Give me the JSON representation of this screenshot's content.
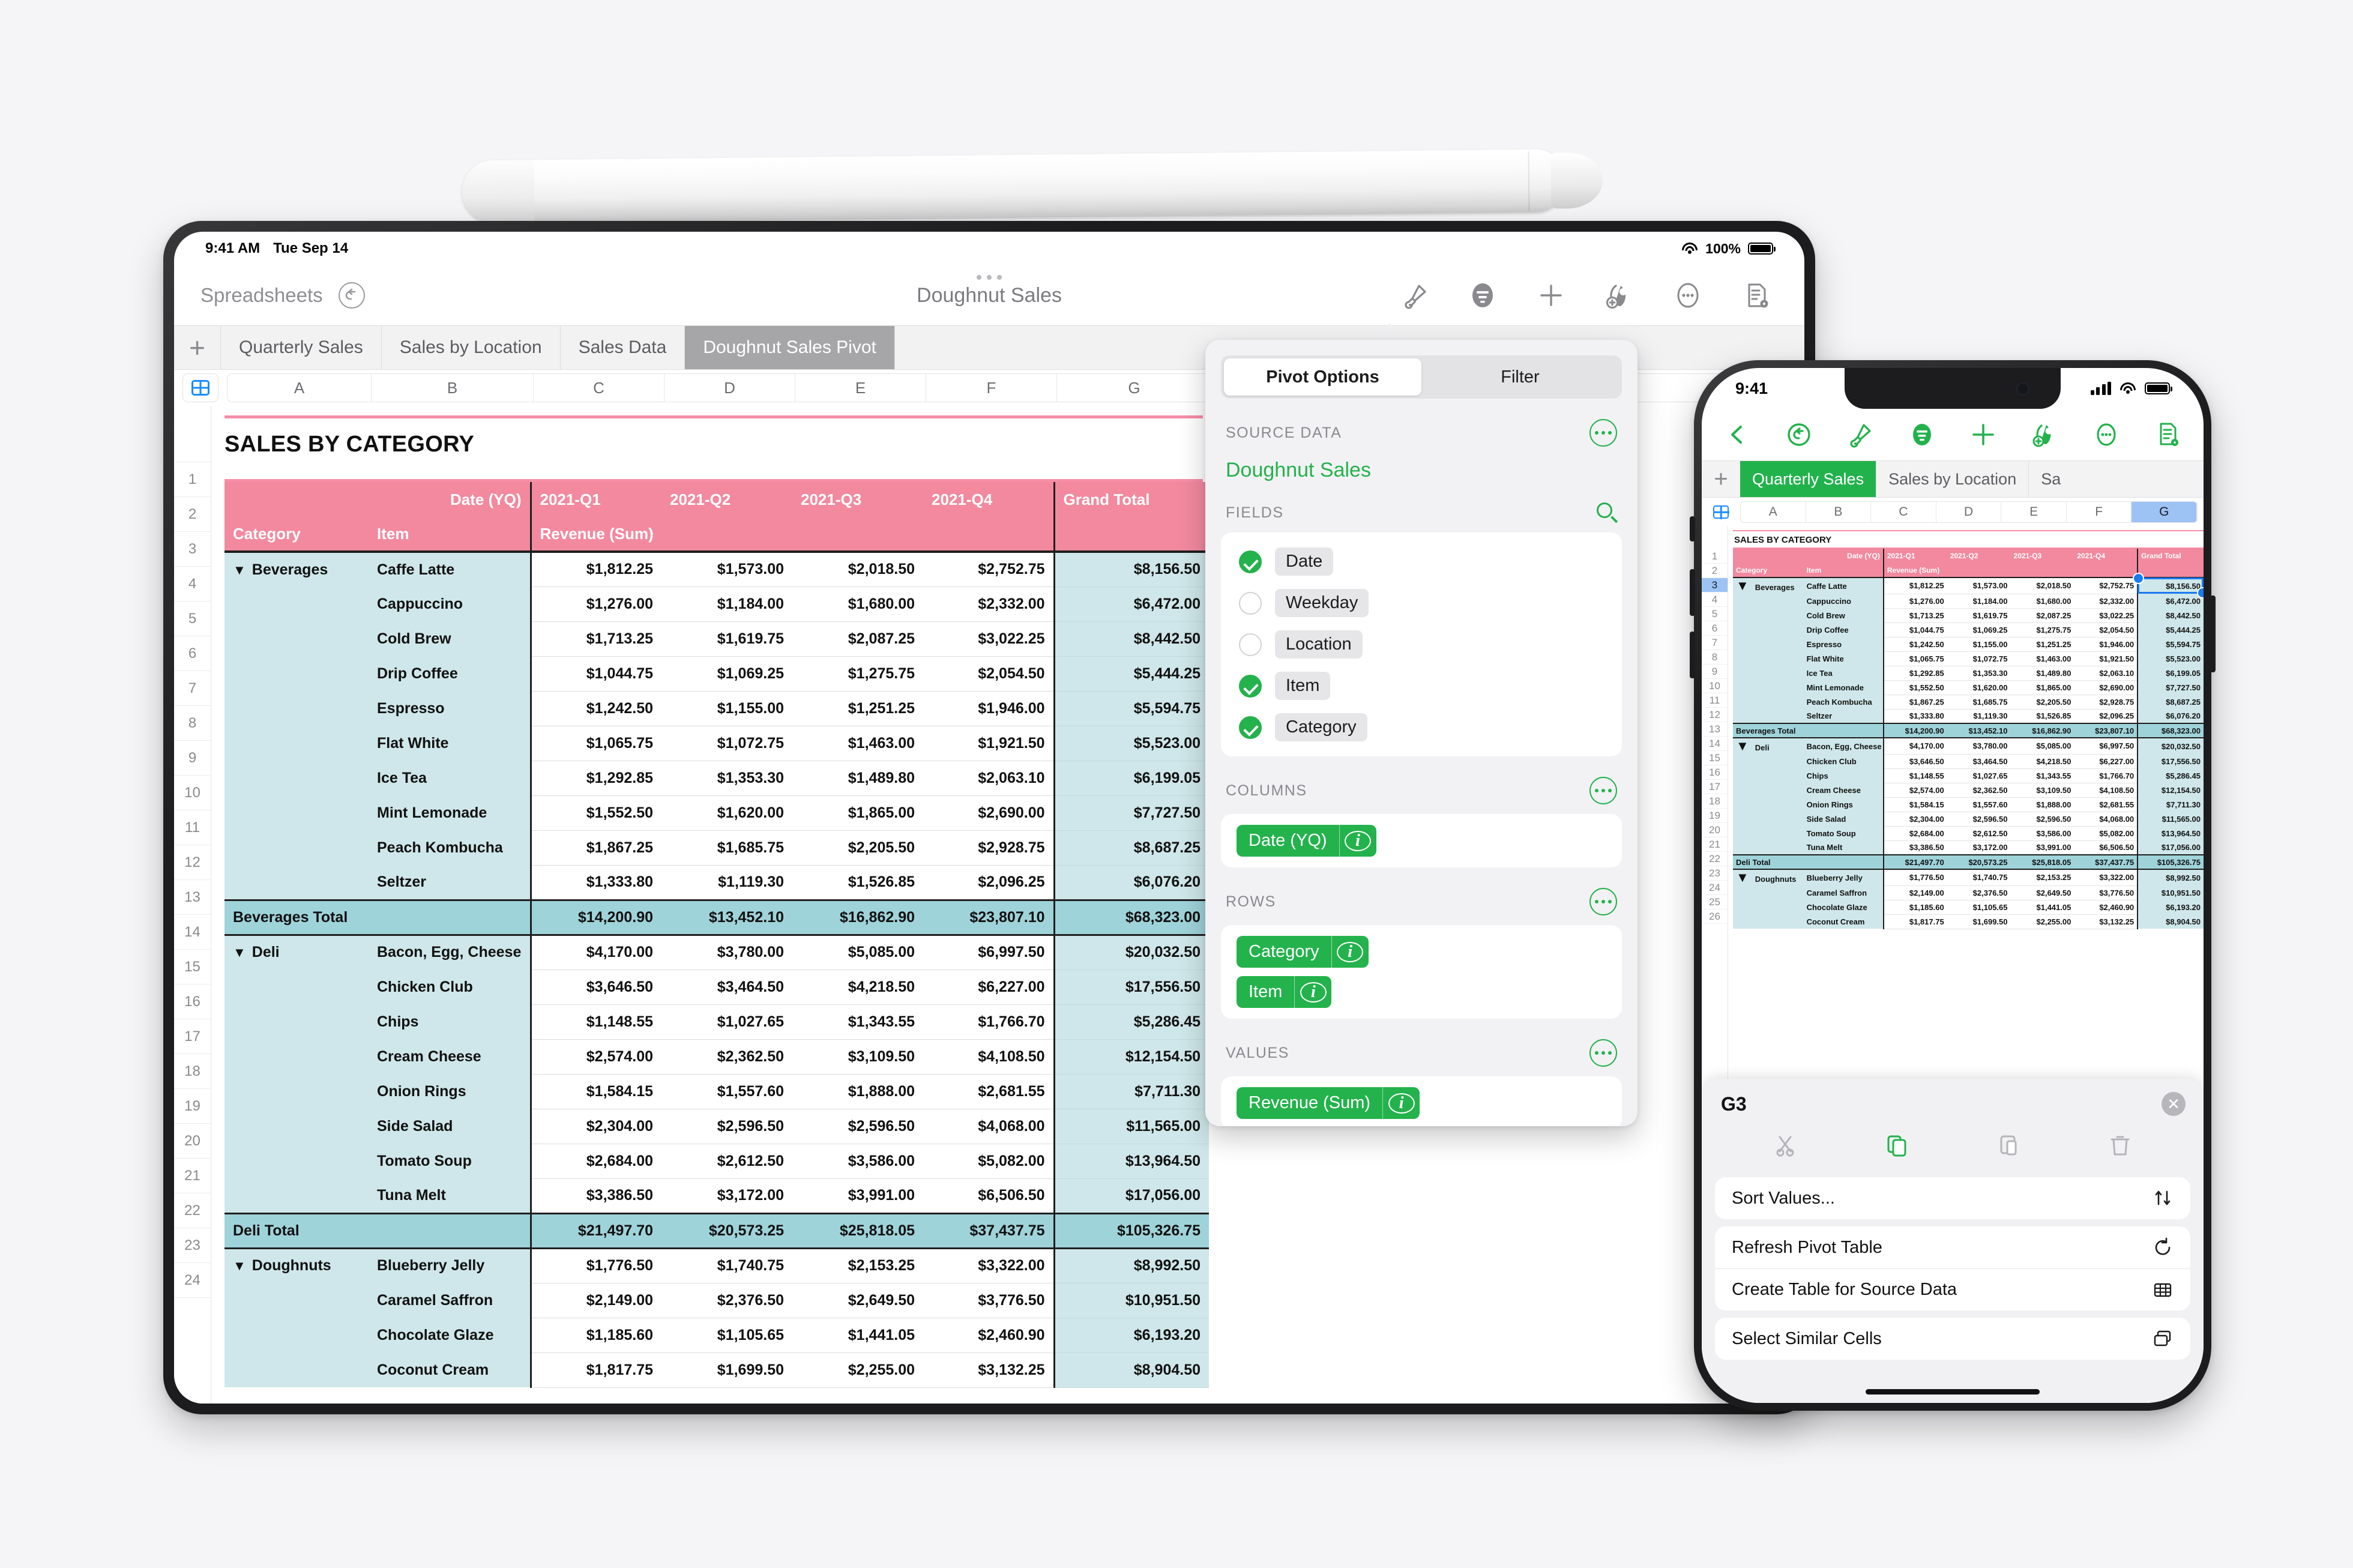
{
  "ipad": {
    "status": {
      "time": "9:41 AM",
      "date": "Tue Sep 14",
      "battery_pct": "100%"
    },
    "nav": {
      "back_label": "Spreadsheets",
      "undo_icon": "undo-icon",
      "doc_title": "Doughnut Sales"
    },
    "tools": [
      {
        "name": "format-brush-icon",
        "label": "Format"
      },
      {
        "name": "pivot-options-icon",
        "label": "Organize"
      },
      {
        "name": "insert-plus-icon",
        "label": "Insert"
      },
      {
        "name": "collaborate-icon",
        "label": "Collaborate"
      },
      {
        "name": "more-ellipsis-icon",
        "label": "More"
      },
      {
        "name": "document-icon",
        "label": "Document"
      }
    ],
    "tabbar": {
      "add_label": "+",
      "tabs": [
        {
          "label": "Quarterly Sales",
          "active": false
        },
        {
          "label": "Sales by Location",
          "active": false
        },
        {
          "label": "Sales Data",
          "active": false
        },
        {
          "label": "Doughnut Sales Pivot",
          "active": true
        }
      ]
    },
    "columns": [
      "A",
      "B",
      "C",
      "D",
      "E",
      "F",
      "G"
    ],
    "row_numbers": [
      "1",
      "2",
      "3",
      "4",
      "5",
      "6",
      "7",
      "8",
      "9",
      "10",
      "11",
      "12",
      "13",
      "14",
      "15",
      "16",
      "17",
      "18",
      "19",
      "20",
      "21",
      "22",
      "23",
      "24"
    ]
  },
  "sheet": {
    "title": "SALES BY CATEGORY",
    "header_row1": {
      "date_label": "Date (YQ)",
      "quarters": [
        "2021-Q1",
        "2021-Q2",
        "2021-Q3",
        "2021-Q4"
      ],
      "grand_total": "Grand Total"
    },
    "header_row2": {
      "category": "Category",
      "item": "Item",
      "measure": "Revenue (Sum)"
    }
  },
  "chart_data": {
    "type": "table",
    "title": "SALES BY CATEGORY",
    "columns": [
      "Category",
      "Item",
      "2021-Q1",
      "2021-Q2",
      "2021-Q3",
      "2021-Q4",
      "Grand Total"
    ],
    "rows": [
      {
        "n": 3,
        "category": "Beverages",
        "item": "Caffe Latte",
        "q1": "$1,812.25",
        "q2": "$1,573.00",
        "q3": "$2,018.50",
        "q4": "$2,752.75",
        "total": "$8,156.50"
      },
      {
        "n": 4,
        "category": "",
        "item": "Cappuccino",
        "q1": "$1,276.00",
        "q2": "$1,184.00",
        "q3": "$1,680.00",
        "q4": "$2,332.00",
        "total": "$6,472.00"
      },
      {
        "n": 5,
        "category": "",
        "item": "Cold Brew",
        "q1": "$1,713.25",
        "q2": "$1,619.75",
        "q3": "$2,087.25",
        "q4": "$3,022.25",
        "total": "$8,442.50"
      },
      {
        "n": 6,
        "category": "",
        "item": "Drip Coffee",
        "q1": "$1,044.75",
        "q2": "$1,069.25",
        "q3": "$1,275.75",
        "q4": "$2,054.50",
        "total": "$5,444.25"
      },
      {
        "n": 7,
        "category": "",
        "item": "Espresso",
        "q1": "$1,242.50",
        "q2": "$1,155.00",
        "q3": "$1,251.25",
        "q4": "$1,946.00",
        "total": "$5,594.75"
      },
      {
        "n": 8,
        "category": "",
        "item": "Flat White",
        "q1": "$1,065.75",
        "q2": "$1,072.75",
        "q3": "$1,463.00",
        "q4": "$1,921.50",
        "total": "$5,523.00"
      },
      {
        "n": 9,
        "category": "",
        "item": "Ice Tea",
        "q1": "$1,292.85",
        "q2": "$1,353.30",
        "q3": "$1,489.80",
        "q4": "$2,063.10",
        "total": "$6,199.05"
      },
      {
        "n": 10,
        "category": "",
        "item": "Mint Lemonade",
        "q1": "$1,552.50",
        "q2": "$1,620.00",
        "q3": "$1,865.00",
        "q4": "$2,690.00",
        "total": "$7,727.50"
      },
      {
        "n": 11,
        "category": "",
        "item": "Peach Kombucha",
        "q1": "$1,867.25",
        "q2": "$1,685.75",
        "q3": "$2,205.50",
        "q4": "$2,928.75",
        "total": "$8,687.25"
      },
      {
        "n": 12,
        "category": "",
        "item": "Seltzer",
        "q1": "$1,333.80",
        "q2": "$1,119.30",
        "q3": "$1,526.85",
        "q4": "$2,096.25",
        "total": "$6,076.20"
      },
      {
        "n": 13,
        "category": "Beverages Total",
        "item": "",
        "q1": "$14,200.90",
        "q2": "$13,452.10",
        "q3": "$16,862.90",
        "q4": "$23,807.10",
        "total": "$68,323.00",
        "is_total": true
      },
      {
        "n": 14,
        "category": "Deli",
        "item": "Bacon, Egg, Cheese",
        "q1": "$4,170.00",
        "q2": "$3,780.00",
        "q3": "$5,085.00",
        "q4": "$6,997.50",
        "total": "$20,032.50"
      },
      {
        "n": 15,
        "category": "",
        "item": "Chicken Club",
        "q1": "$3,646.50",
        "q2": "$3,464.50",
        "q3": "$4,218.50",
        "q4": "$6,227.00",
        "total": "$17,556.50"
      },
      {
        "n": 16,
        "category": "",
        "item": "Chips",
        "q1": "$1,148.55",
        "q2": "$1,027.65",
        "q3": "$1,343.55",
        "q4": "$1,766.70",
        "total": "$5,286.45"
      },
      {
        "n": 17,
        "category": "",
        "item": "Cream Cheese",
        "q1": "$2,574.00",
        "q2": "$2,362.50",
        "q3": "$3,109.50",
        "q4": "$4,108.50",
        "total": "$12,154.50"
      },
      {
        "n": 18,
        "category": "",
        "item": "Onion Rings",
        "q1": "$1,584.15",
        "q2": "$1,557.60",
        "q3": "$1,888.00",
        "q4": "$2,681.55",
        "total": "$7,711.30"
      },
      {
        "n": 19,
        "category": "",
        "item": "Side Salad",
        "q1": "$2,304.00",
        "q2": "$2,596.50",
        "q3": "$2,596.50",
        "q4": "$4,068.00",
        "total": "$11,565.00"
      },
      {
        "n": 20,
        "category": "",
        "item": "Tomato Soup",
        "q1": "$2,684.00",
        "q2": "$2,612.50",
        "q3": "$3,586.00",
        "q4": "$5,082.00",
        "total": "$13,964.50"
      },
      {
        "n": 21,
        "category": "",
        "item": "Tuna Melt",
        "q1": "$3,386.50",
        "q2": "$3,172.00",
        "q3": "$3,991.00",
        "q4": "$6,506.50",
        "total": "$17,056.00"
      },
      {
        "n": 22,
        "category": "Deli Total",
        "item": "",
        "q1": "$21,497.70",
        "q2": "$20,573.25",
        "q3": "$25,818.05",
        "q4": "$37,437.75",
        "total": "$105,326.75",
        "is_total": true
      },
      {
        "n": 23,
        "category": "Doughnuts",
        "item": "Blueberry Jelly",
        "q1": "$1,776.50",
        "q2": "$1,740.75",
        "q3": "$2,153.25",
        "q4": "$3,322.00",
        "total": "$8,992.50"
      },
      {
        "n": 24,
        "category": "",
        "item": "Caramel Saffron",
        "q1": "$2,149.00",
        "q2": "$2,376.50",
        "q3": "$2,649.50",
        "q4": "$3,776.50",
        "total": "$10,951.50"
      },
      {
        "n": 25,
        "category": "",
        "item": "Chocolate Glaze",
        "q1": "$1,185.60",
        "q2": "$1,105.65",
        "q3": "$1,441.05",
        "q4": "$2,460.90",
        "total": "$6,193.20"
      },
      {
        "n": 26,
        "category": "",
        "item": "Coconut Cream",
        "q1": "$1,817.75",
        "q2": "$1,699.50",
        "q3": "$2,255.00",
        "q4": "$3,132.25",
        "total": "$8,904.50"
      }
    ]
  },
  "popover": {
    "segments": [
      {
        "label": "Pivot Options",
        "active": true
      },
      {
        "label": "Filter",
        "active": false
      }
    ],
    "source_data": {
      "section_label": "SOURCE DATA",
      "value": "Doughnut Sales",
      "menu_icon": "ellipsis-circle-icon"
    },
    "fields": {
      "section_label": "FIELDS",
      "search_icon": "search-icon",
      "items": [
        {
          "label": "Date",
          "checked": true
        },
        {
          "label": "Weekday",
          "checked": false
        },
        {
          "label": "Location",
          "checked": false
        },
        {
          "label": "Item",
          "checked": true
        },
        {
          "label": "Category",
          "checked": true
        }
      ]
    },
    "columns": {
      "section_label": "COLUMNS",
      "menu_icon": "ellipsis-circle-icon",
      "pills": [
        "Date (YQ)"
      ]
    },
    "rows": {
      "section_label": "ROWS",
      "menu_icon": "ellipsis-circle-icon",
      "pills": [
        "Category",
        "Item"
      ]
    },
    "values": {
      "section_label": "VALUES",
      "menu_icon": "ellipsis-circle-icon",
      "pills": [
        "Revenue (Sum)"
      ]
    }
  },
  "iphone": {
    "status": {
      "time": "9:41"
    },
    "tools": [
      {
        "name": "back-chevron-icon"
      },
      {
        "name": "undo-icon"
      },
      {
        "name": "format-brush-icon"
      },
      {
        "name": "pivot-options-icon"
      },
      {
        "name": "insert-plus-icon"
      },
      {
        "name": "collaborate-icon"
      },
      {
        "name": "more-ellipsis-icon"
      },
      {
        "name": "document-icon"
      }
    ],
    "tabbar": {
      "add_label": "+",
      "tabs": [
        {
          "label": "Quarterly Sales",
          "active": true
        },
        {
          "label": "Sales by Location",
          "active": false
        },
        {
          "label": "Sa",
          "active": false
        }
      ]
    },
    "columns": [
      "A",
      "B",
      "C",
      "D",
      "E",
      "F",
      "G"
    ],
    "selected_column": "G",
    "selected_row": "3",
    "sheet_menu": {
      "cell_ref": "G3",
      "close_icon": "close-icon",
      "actions": [
        {
          "name": "cut-icon",
          "enabled": false
        },
        {
          "name": "copy-icon",
          "enabled": true
        },
        {
          "name": "paste-icon",
          "enabled": false
        },
        {
          "name": "delete-icon",
          "enabled": false
        }
      ],
      "menu_groups": [
        [
          {
            "label": "Sort Values...",
            "icon": "sort-arrows-icon"
          }
        ],
        [
          {
            "label": "Refresh Pivot Table",
            "icon": "refresh-icon"
          },
          {
            "label": "Create Table for Source Data",
            "icon": "table-icon"
          }
        ],
        [
          {
            "label": "Select Similar Cells",
            "icon": "select-similar-icon"
          }
        ]
      ]
    }
  },
  "colors": {
    "accent_green": "#22b24c",
    "header_pink": "#f2899f",
    "row_teal": "#cfe7ea",
    "total_teal": "#9fd3da",
    "selection_blue": "#1a7af0"
  }
}
